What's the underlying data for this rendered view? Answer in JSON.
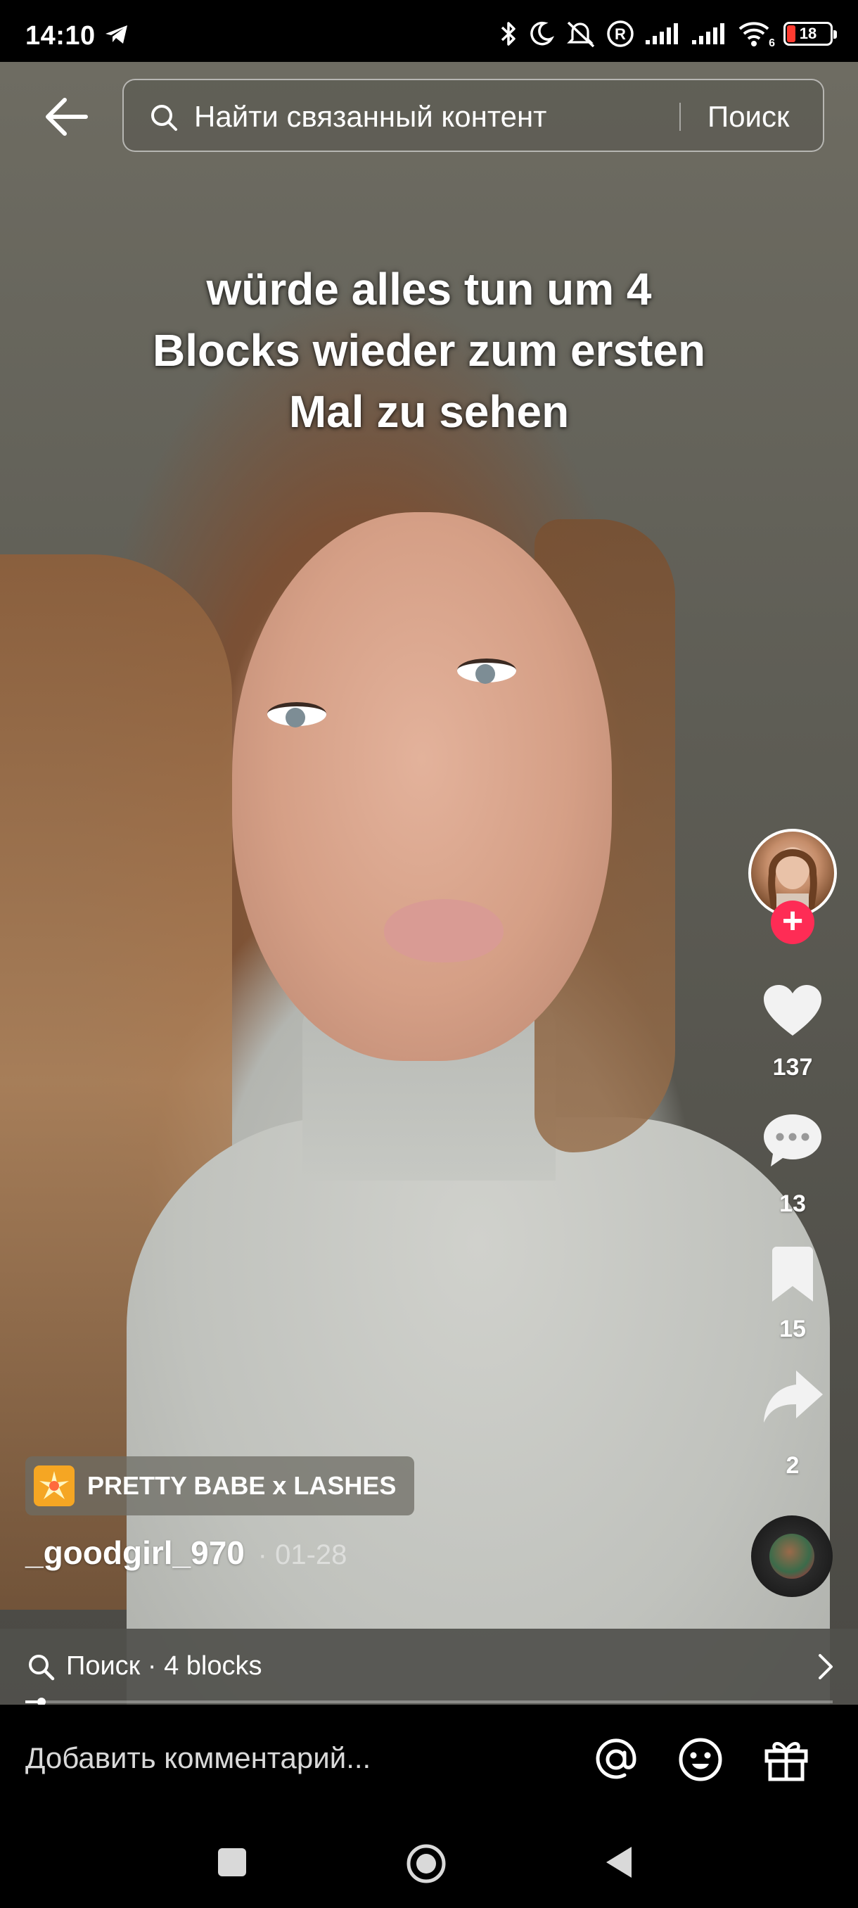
{
  "status_bar": {
    "time": "14:10",
    "battery": "18",
    "network_tag": "6",
    "icons": [
      "telegram-icon",
      "bluetooth-icon",
      "moon-icon",
      "muted-icon",
      "registered-icon",
      "signal-icon",
      "signal-icon",
      "wifi-icon",
      "battery-icon"
    ]
  },
  "header": {
    "search_placeholder": "Найти связанный контент",
    "search_button": "Поиск"
  },
  "video": {
    "caption_lines": [
      "würde alles tun um 4",
      "Blocks wieder zum ersten",
      "Mal zu sehen"
    ],
    "effect_label": "PRETTY BABE x LASHES",
    "author": "_goodgirl_970",
    "date": "· 01-28",
    "progress": 0.02
  },
  "actions": {
    "likes": "137",
    "comments": "13",
    "saves": "15",
    "shares": "2"
  },
  "search_suggestion": {
    "text": "Поиск · 4 blocks"
  },
  "comment_bar": {
    "placeholder": "Добавить комментарий..."
  },
  "colors": {
    "accent": "#fe2c55",
    "effect_icon": "#f5a623"
  }
}
